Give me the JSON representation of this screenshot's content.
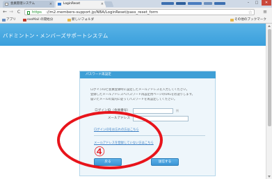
{
  "browser": {
    "tabs": [
      {
        "label": "会員管理システム"
      },
      {
        "label": "LoginReset"
      }
    ],
    "controls": {
      "minimize": "–",
      "maximize": "□",
      "close": "✕"
    },
    "url": {
      "scheme": "https",
      "rest": "://m2.members-support.jp/NBA/LoginReset/pass_reset_form"
    },
    "bookmarks": [
      {
        "label": "アプリ",
        "icon": "apps-grid-icon"
      },
      {
        "label": "exeMail の開始分",
        "icon": "mail-icon"
      },
      {
        "label": "新しいフォルダ",
        "icon": "folder-icon"
      },
      {
        "label": "その他のブックマーク",
        "icon": "folder-icon"
      }
    ]
  },
  "site": {
    "title": "バドミントン・メンバーズサポートシステム",
    "header_color": "#3fa4df"
  },
  "form": {
    "title": "パスワード再設定",
    "instructions": [
      "ログインIDと会員登録時に設定したメールアドレスを入力してください。",
      "登録したメールアドレスへパスワード再設定用ページのURLをお送りします。",
      "届いたメールの案内に従ってパスワードを再設定してください。"
    ],
    "fields": [
      {
        "label": "ログインID（会員番号）",
        "value": "",
        "hint": "例"
      },
      {
        "label": "メールアドレス",
        "value": "",
        "hint": ""
      }
    ],
    "links": [
      "ログインIDをお忘れの方はこちら",
      "メールアドレスを登録していない方はこちら"
    ],
    "buttons": {
      "back": "戻る",
      "submit": "送信する"
    }
  },
  "annotation": {
    "number": "④",
    "color": "#e8141b"
  }
}
